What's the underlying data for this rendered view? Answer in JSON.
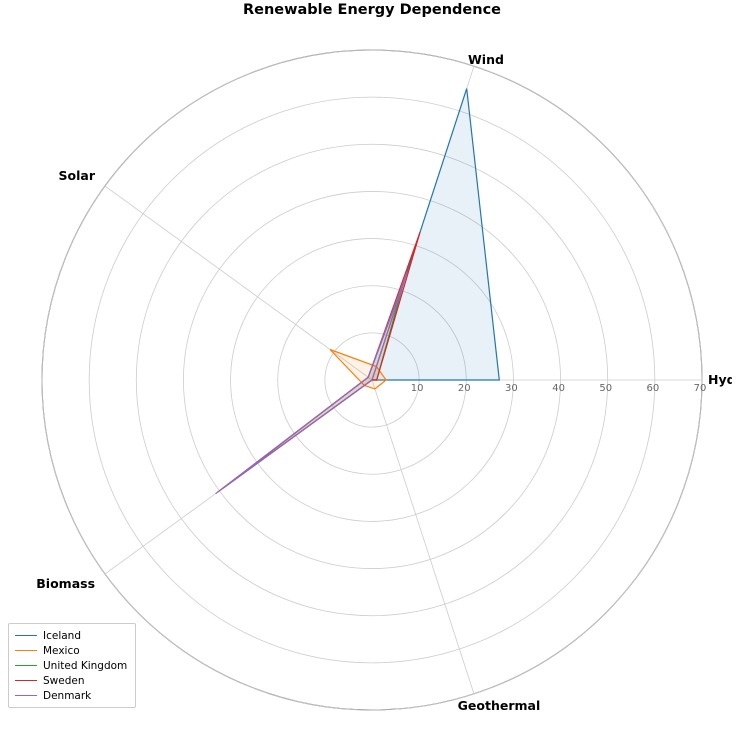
{
  "title": "Renewable Energy Dependence",
  "chart_data": {
    "type": "radar",
    "categories": [
      "Hydro",
      "Wind",
      "Solar",
      "Biomass",
      "Geothermal"
    ],
    "r_ticks": [
      10,
      20,
      30,
      40,
      50,
      60,
      70
    ],
    "r_max": 70,
    "series": [
      {
        "name": "Iceland",
        "color": "#1f77b4",
        "values": [
          27,
          65,
          0,
          1,
          0
        ]
      },
      {
        "name": "Mexico",
        "color": "#ff7f0e",
        "values": [
          3,
          3,
          11,
          2,
          2
        ]
      },
      {
        "name": "United Kingdom",
        "color": "#2ca02c",
        "values": [
          1,
          22,
          1,
          39,
          0
        ]
      },
      {
        "name": "Sweden",
        "color": "#d62728",
        "values": [
          1,
          33,
          1,
          40,
          0
        ]
      },
      {
        "name": "Denmark",
        "color": "#9467bd",
        "values": [
          0,
          24,
          1,
          41,
          0
        ]
      }
    ],
    "axis_labels": {
      "Hydro": "Hydro",
      "Wind": "Wind",
      "Solar": "Solar",
      "Biomass": "Biomass",
      "Geothermal": "Geothermal"
    }
  },
  "legend": {
    "items": [
      {
        "label": "Iceland",
        "color": "#1f77b4"
      },
      {
        "label": "Mexico",
        "color": "#ff7f0e"
      },
      {
        "label": "United Kingdom",
        "color": "#2ca02c"
      },
      {
        "label": "Sweden",
        "color": "#d62728"
      },
      {
        "label": "Denmark",
        "color": "#9467bd"
      }
    ]
  }
}
